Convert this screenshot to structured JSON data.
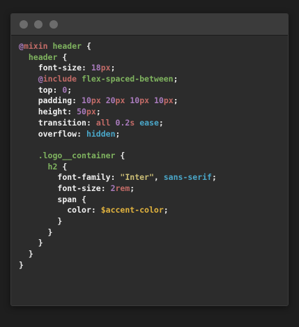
{
  "window": {
    "buttons": [
      "close",
      "minimize",
      "maximize"
    ]
  },
  "code": {
    "lines": [
      [
        [
          "t-at",
          "@"
        ],
        [
          "t-kw",
          "mixin"
        ],
        [
          "t-pun",
          " "
        ],
        [
          "t-mix",
          "header"
        ],
        [
          "t-pun",
          " {"
        ]
      ],
      [
        [
          "t-pun",
          "  "
        ],
        [
          "t-sel",
          "header"
        ],
        [
          "t-pun",
          " {"
        ]
      ],
      [
        [
          "t-pun",
          "    "
        ],
        [
          "t-prop",
          "font-size"
        ],
        [
          "t-pun",
          ": "
        ],
        [
          "t-num",
          "18"
        ],
        [
          "t-unit",
          "px"
        ],
        [
          "t-pun",
          ";"
        ]
      ],
      [
        [
          "t-pun",
          "    "
        ],
        [
          "t-at",
          "@"
        ],
        [
          "t-kw",
          "include"
        ],
        [
          "t-pun",
          " "
        ],
        [
          "t-mix",
          "flex-spaced-between"
        ],
        [
          "t-pun",
          ";"
        ]
      ],
      [
        [
          "t-pun",
          "    "
        ],
        [
          "t-prop",
          "top"
        ],
        [
          "t-pun",
          ": "
        ],
        [
          "t-num",
          "0"
        ],
        [
          "t-pun",
          ";"
        ]
      ],
      [
        [
          "t-pun",
          "    "
        ],
        [
          "t-prop",
          "padding"
        ],
        [
          "t-pun",
          ": "
        ],
        [
          "t-num",
          "10"
        ],
        [
          "t-unit",
          "px"
        ],
        [
          "t-pun",
          " "
        ],
        [
          "t-num",
          "20"
        ],
        [
          "t-unit",
          "px"
        ],
        [
          "t-pun",
          " "
        ],
        [
          "t-num",
          "10"
        ],
        [
          "t-unit",
          "px"
        ],
        [
          "t-pun",
          " "
        ],
        [
          "t-num",
          "10"
        ],
        [
          "t-unit",
          "px"
        ],
        [
          "t-pun",
          ";"
        ]
      ],
      [
        [
          "t-pun",
          "    "
        ],
        [
          "t-prop",
          "height"
        ],
        [
          "t-pun",
          ": "
        ],
        [
          "t-num",
          "50"
        ],
        [
          "t-unit",
          "px"
        ],
        [
          "t-pun",
          ";"
        ]
      ],
      [
        [
          "t-pun",
          "    "
        ],
        [
          "t-prop",
          "transition"
        ],
        [
          "t-pun",
          ": "
        ],
        [
          "t-kw",
          "all"
        ],
        [
          "t-pun",
          " "
        ],
        [
          "t-num",
          "0.2"
        ],
        [
          "t-unit",
          "s"
        ],
        [
          "t-pun",
          " "
        ],
        [
          "t-val",
          "ease"
        ],
        [
          "t-pun",
          ";"
        ]
      ],
      [
        [
          "t-pun",
          "    "
        ],
        [
          "t-prop",
          "overflow"
        ],
        [
          "t-pun",
          ": "
        ],
        [
          "t-val",
          "hidden"
        ],
        [
          "t-pun",
          ";"
        ]
      ],
      [
        [
          "t-pun",
          ""
        ]
      ],
      [
        [
          "t-pun",
          "    "
        ],
        [
          "t-sel",
          ".logo__container"
        ],
        [
          "t-pun",
          " {"
        ]
      ],
      [
        [
          "t-pun",
          "      "
        ],
        [
          "t-sel",
          "h2"
        ],
        [
          "t-pun",
          " {"
        ]
      ],
      [
        [
          "t-pun",
          "        "
        ],
        [
          "t-prop",
          "font-family"
        ],
        [
          "t-pun",
          ": "
        ],
        [
          "t-str",
          "\"Inter\""
        ],
        [
          "t-pun",
          ", "
        ],
        [
          "t-val",
          "sans-serif"
        ],
        [
          "t-pun",
          ";"
        ]
      ],
      [
        [
          "t-pun",
          "        "
        ],
        [
          "t-prop",
          "font-size"
        ],
        [
          "t-pun",
          ": "
        ],
        [
          "t-num",
          "2"
        ],
        [
          "t-unit",
          "rem"
        ],
        [
          "t-pun",
          ";"
        ]
      ],
      [
        [
          "t-pun",
          "        "
        ],
        [
          "t-prop",
          "span"
        ],
        [
          "t-pun",
          " {"
        ]
      ],
      [
        [
          "t-pun",
          "          "
        ],
        [
          "t-prop",
          "color"
        ],
        [
          "t-pun",
          ": "
        ],
        [
          "t-var",
          "$accent-color"
        ],
        [
          "t-pun",
          ";"
        ]
      ],
      [
        [
          "t-pun",
          "        }"
        ]
      ],
      [
        [
          "t-pun",
          "      }"
        ]
      ],
      [
        [
          "t-pun",
          "    }"
        ]
      ],
      [
        [
          "t-pun",
          "  }"
        ]
      ],
      [
        [
          "t-pun",
          "}"
        ]
      ]
    ]
  }
}
